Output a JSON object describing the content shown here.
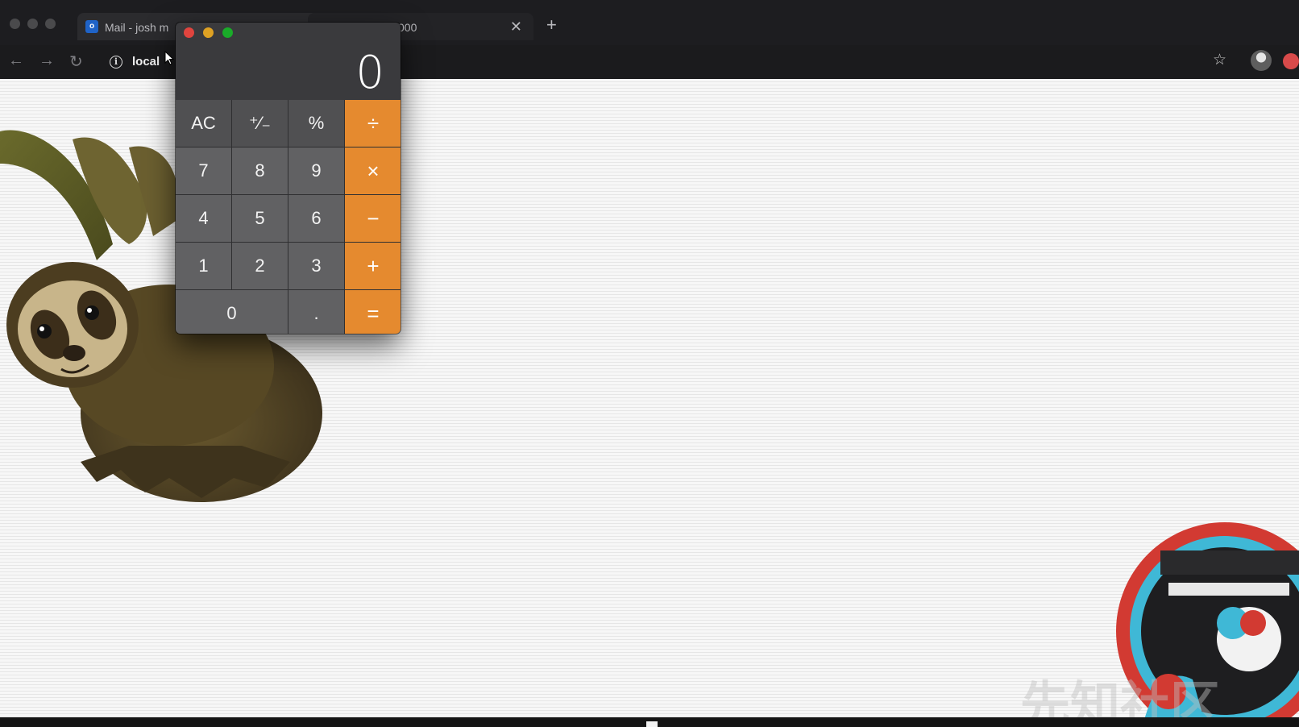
{
  "browser": {
    "tabs": [
      {
        "title": "Mail - josh m",
        "icon": "outlook-icon",
        "icon_text": "o"
      },
      {
        "title": "000",
        "close_label": "✕"
      }
    ],
    "new_tab_label": "+",
    "nav": {
      "back": "←",
      "forward": "→",
      "reload": "↻"
    },
    "url": "local",
    "info_glyph": "i",
    "star_glyph": "☆"
  },
  "calculator": {
    "display": "0",
    "keys": [
      {
        "label": "AC",
        "kind": "fn"
      },
      {
        "label": "⁺⁄₋",
        "kind": "fn"
      },
      {
        "label": "%",
        "kind": "fn"
      },
      {
        "label": "÷",
        "kind": "op"
      },
      {
        "label": "7",
        "kind": "num"
      },
      {
        "label": "8",
        "kind": "num"
      },
      {
        "label": "9",
        "kind": "num"
      },
      {
        "label": "×",
        "kind": "op"
      },
      {
        "label": "4",
        "kind": "num"
      },
      {
        "label": "5",
        "kind": "num"
      },
      {
        "label": "6",
        "kind": "num"
      },
      {
        "label": "−",
        "kind": "op"
      },
      {
        "label": "1",
        "kind": "num"
      },
      {
        "label": "2",
        "kind": "num"
      },
      {
        "label": "3",
        "kind": "num"
      },
      {
        "label": "+",
        "kind": "op"
      },
      {
        "label": "0",
        "kind": "zero"
      },
      {
        "label": ".",
        "kind": "num"
      },
      {
        "label": "=",
        "kind": "op"
      }
    ]
  },
  "colors": {
    "accent": "#e58a2f",
    "close_light": "#e0443e",
    "minimize_light": "#dea123",
    "zoom_light": "#1aab29"
  },
  "watermark": "先知社区"
}
